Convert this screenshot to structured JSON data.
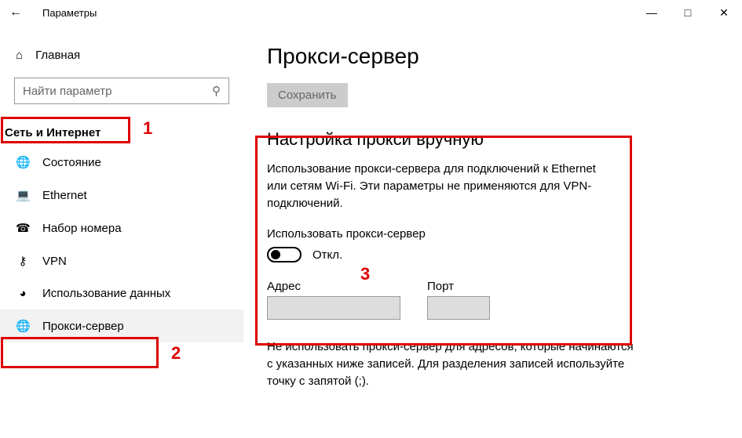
{
  "window": {
    "title": "Параметры"
  },
  "sidebar": {
    "home_label": "Главная",
    "search_placeholder": "Найти параметр",
    "category_label": "Сеть и Интернет",
    "items": [
      {
        "label": "Состояние"
      },
      {
        "label": "Ethernet"
      },
      {
        "label": "Набор номера"
      },
      {
        "label": "VPN"
      },
      {
        "label": "Использование данных"
      },
      {
        "label": "Прокси-сервер"
      }
    ]
  },
  "content": {
    "page_title": "Прокси-сервер",
    "save_label": "Сохранить",
    "section_title": "Настройка прокси вручную",
    "description": "Использование прокси-сервера для подключений к Ethernet или сетям Wi-Fi. Эти параметры не применяются для VPN-подключений.",
    "use_proxy_label": "Использовать прокси-сервер",
    "toggle_state": "Откл.",
    "address_label": "Адрес",
    "port_label": "Порт",
    "exclusion_text": "Не использовать прокси-сервер для адресов, которые начинаются с указанных ниже записей. Для разделения записей используйте точку с запятой (;)."
  },
  "annotations": {
    "n1": "1",
    "n2": "2",
    "n3": "3"
  }
}
